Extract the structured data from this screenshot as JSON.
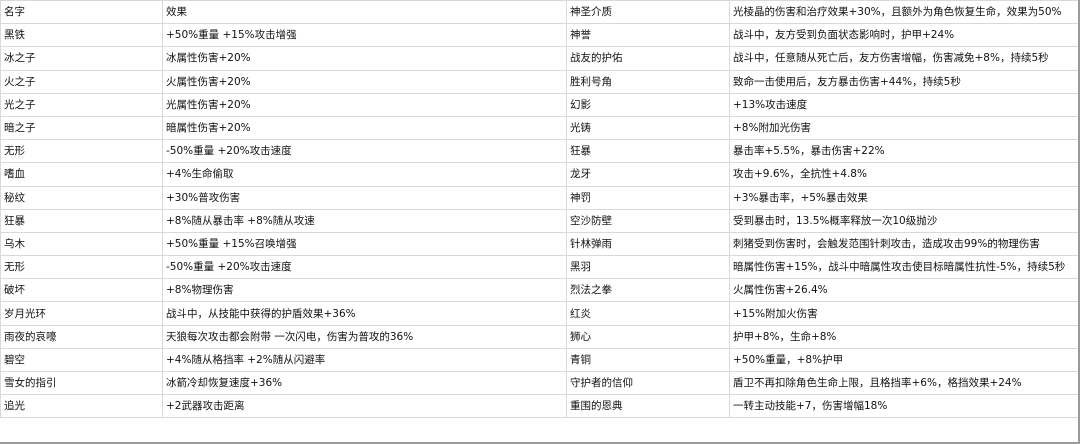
{
  "header": [
    "名字",
    "效果",
    "神圣介质",
    "光棱晶的伤害和治疗效果+30%，且额外为角色恢复生命，效果为50%"
  ],
  "rows": [
    [
      "黑铁",
      " +50%重量 +15%攻击增强",
      "神誉",
      "战斗中，友方受到负面状态影响时，护甲+24%"
    ],
    [
      "冰之子",
      "冰属性伤害+20%",
      "战友的护佑",
      "战斗中，任意随从死亡后，友方伤害增幅，伤害减免+8%，持续5秒"
    ],
    [
      "火之子",
      "火属性伤害+20%",
      "胜利号角",
      "致命一击使用后，友方暴击伤害+44%，持续5秒"
    ],
    [
      "光之子",
      "光属性伤害+20%",
      "幻影",
      " +13%攻击速度"
    ],
    [
      "暗之子",
      "暗属性伤害+20%",
      "光铸",
      " +8%附加光伤害"
    ],
    [
      "无形",
      " -50%重量 +20%攻击速度",
      "狂暴",
      " 暴击率+5.5%，暴击伤害+22%"
    ],
    [
      "嗜血",
      " +4%生命偷取",
      "龙牙",
      "攻击+9.6%，全抗性+4.8%"
    ],
    [
      "秘纹",
      " +30%普攻伤害",
      "神罚",
      " +3%暴击率，+5%暴击效果"
    ],
    [
      "狂暴",
      " +8%随从暴击率 +8%随从攻速",
      "空沙防壁",
      "受到暴击时，13.5%概率释放一次10级抛沙"
    ],
    [
      "乌木",
      " +50%重量 +15%召唤增强",
      "针林弹雨",
      "刺猪受到伤害时，会触发范围针刺攻击，造成攻击99%的物理伤害"
    ],
    [
      "无形",
      " -50%重量 +20%攻击速度",
      "黑羽",
      "暗属性伤害+15%，战斗中暗属性攻击使目标暗属性抗性-5%，持续5秒"
    ],
    [
      "破坏",
      " +8%物理伤害",
      "烈法之拳",
      "火属性伤害+26.4%"
    ],
    [
      "岁月光环",
      "战斗中，从技能中获得的护盾效果+36%",
      "红炎",
      " +15%附加火伤害"
    ],
    [
      "雨夜的哀嚎",
      "天狼每次攻击都会附带 一次闪电，伤害为普攻的36%",
      "狮心",
      "护甲+8%，生命+8%"
    ],
    [
      "碧空",
      " +4%随从格挡率 +2%随从闪避率",
      "青铜",
      " +50%重量，+8%护甲"
    ],
    [
      "雪女的指引",
      "冰箭冷却恢复速度+36%",
      "守护者的信仰",
      "盾卫不再扣除角色生命上限，且格挡率+6%，格挡效果+24%"
    ],
    [
      "追光",
      " +2武器攻击距离",
      "重围的恩典",
      "一转主动技能+7，伤害增幅18%"
    ]
  ]
}
